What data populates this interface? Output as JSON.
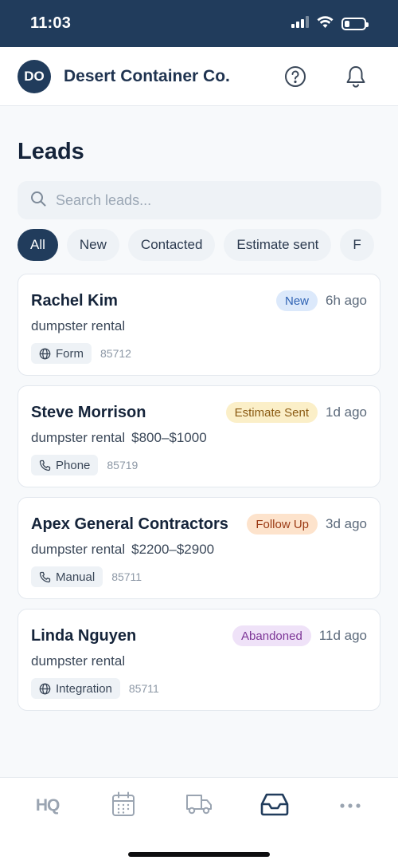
{
  "status_bar": {
    "time": "11:03",
    "icons": [
      "signal-icon",
      "wifi-icon",
      "battery-icon"
    ],
    "battery_level": 0.25
  },
  "header": {
    "avatar_initials": "DO",
    "company_name": "Desert Container Co.",
    "icons": [
      "help-icon",
      "bell-icon"
    ]
  },
  "page": {
    "title": "Leads"
  },
  "search": {
    "placeholder": "Search leads...",
    "value": "",
    "icon": "search-icon"
  },
  "filters": [
    {
      "label": "All",
      "active": true
    },
    {
      "label": "New",
      "active": false
    },
    {
      "label": "Contacted",
      "active": false
    },
    {
      "label": "Estimate sent",
      "active": false
    },
    {
      "label": "F",
      "active": false
    }
  ],
  "leads": [
    {
      "name": "Rachel Kim",
      "status": "New",
      "time": "6h ago",
      "service": "dumpster rental",
      "price": "",
      "source": "Form",
      "source_icon": "globe-icon",
      "zip": "85712"
    },
    {
      "name": "Steve Morrison",
      "status": "Estimate Sent",
      "time": "1d ago",
      "service": "dumpster rental",
      "price": "$800–$1000",
      "source": "Phone",
      "source_icon": "phone-icon",
      "zip": "85719"
    },
    {
      "name": "Apex General Contractors",
      "status": "Follow Up",
      "time": "3d ago",
      "service": "dumpster rental",
      "price": "$2200–$2900",
      "source": "Manual",
      "source_icon": "phone-icon",
      "zip": "85711"
    },
    {
      "name": "Linda Nguyen",
      "status": "Abandoned",
      "time": "11d ago",
      "service": "dumpster rental",
      "price": "",
      "source": "Integration",
      "source_icon": "globe-icon",
      "zip": "85711"
    }
  ],
  "colors": {
    "primary": "#213c5c",
    "badge_new": "#dce9fb",
    "badge_estimate": "#fbefc8",
    "badge_follow": "#fde3cc",
    "badge_abandoned": "#efe2f8"
  },
  "bottom_nav": [
    {
      "label": "HQ",
      "icon": "hq-text-icon",
      "active": false
    },
    {
      "label": "",
      "icon": "calendar-icon",
      "active": false
    },
    {
      "label": "",
      "icon": "truck-icon",
      "active": false
    },
    {
      "label": "",
      "icon": "inbox-icon",
      "active": true
    },
    {
      "label": "",
      "icon": "more-icon",
      "active": false
    }
  ]
}
